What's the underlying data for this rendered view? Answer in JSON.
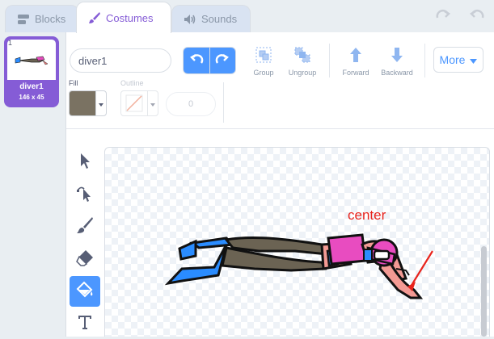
{
  "tabs": [
    {
      "label": "Blocks",
      "icon": "blocks-icon"
    },
    {
      "label": "Costumes",
      "icon": "brush-icon",
      "active": true
    },
    {
      "label": "Sounds",
      "icon": "speaker-icon"
    }
  ],
  "costume": {
    "number": "1",
    "name": "diver1",
    "size": "146 x 45"
  },
  "editor": {
    "costume_name_value": "diver1",
    "group_label": "Group",
    "ungroup_label": "Ungroup",
    "forward_label": "Forward",
    "backward_label": "Backward",
    "more_label": "More",
    "fill_label": "Fill",
    "outline_label": "Outline",
    "outline_width": "0",
    "fill_color": "#7a7262"
  },
  "tools": [
    "select-arrow-icon",
    "reshape-icon",
    "brush-icon",
    "eraser-icon",
    "fill-bucket-icon",
    "text-icon"
  ],
  "annotation": {
    "label": "center",
    "color": "#e8231c"
  },
  "colors": {
    "accent": "#855cd6",
    "primary_blue": "#4c97ff"
  }
}
